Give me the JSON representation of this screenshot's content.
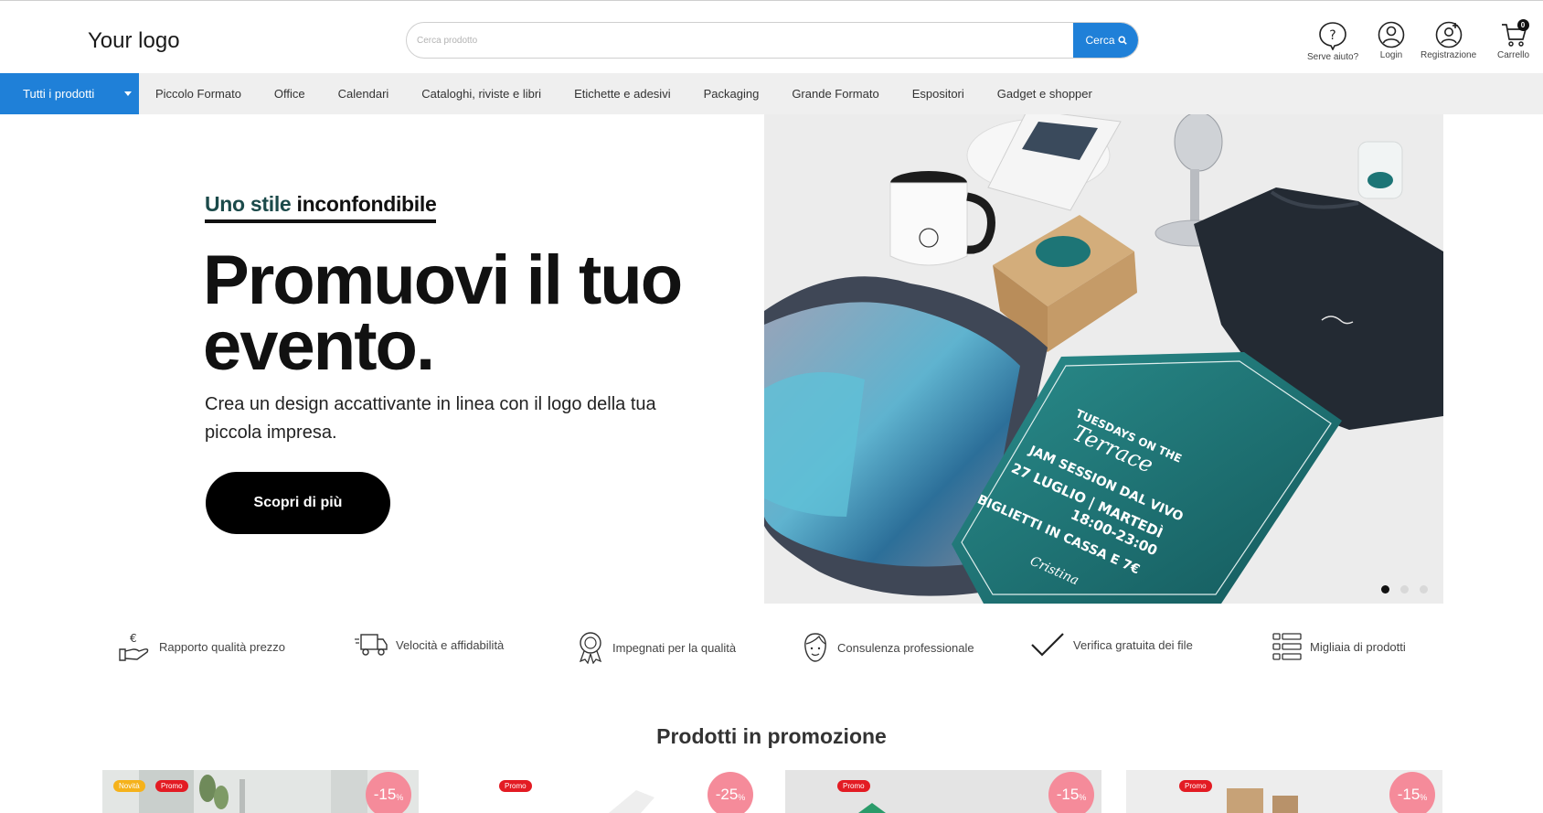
{
  "header": {
    "logo": "Your logo",
    "search_placeholder": "Cerca prodotto",
    "search_button": "Cerca",
    "icons": [
      {
        "name": "help-icon",
        "label": "Serve aiuto?"
      },
      {
        "name": "login-icon",
        "label": "Login"
      },
      {
        "name": "register-icon",
        "label": "Registrazione"
      },
      {
        "name": "cart-icon",
        "label": "Carrello"
      }
    ],
    "cart_count": "0"
  },
  "nav": {
    "all_products": "Tutti i prodotti",
    "items": [
      "Piccolo Formato",
      "Office",
      "Calendari",
      "Cataloghi, riviste e libri",
      "Etichette e adesivi",
      "Packaging",
      "Grande Formato",
      "Espositori",
      "Gadget e shopper"
    ]
  },
  "hero": {
    "kicker_part1": "Uno stile",
    "kicker_part2": "inconfondibile",
    "headline": "Promuovi il tuo evento.",
    "subtext": "Crea un design accattivante in linea con il logo della tua piccola impresa.",
    "cta": "Scopri di più",
    "poster": {
      "line1": "TUESDAYS ON THE",
      "line2": "Terrace",
      "line3": "JAM SESSION DAL VIVO",
      "line4": "27 LUGLIO | MARTEDÌ",
      "line5": "18:00-23:00",
      "line6": "BIGLIETTI IN CASSA E 7€",
      "brand": "Cristina"
    },
    "slides": 3,
    "active_slide": 1
  },
  "features": [
    {
      "icon": "euro-hand-icon",
      "label": "Rapporto qualità prezzo"
    },
    {
      "icon": "delivery-truck-icon",
      "label": "Velocità e affidabilità"
    },
    {
      "icon": "award-ribbon-icon",
      "label": "Impegnati per la qualità"
    },
    {
      "icon": "consultant-face-icon",
      "label": "Consulenza professionale"
    },
    {
      "icon": "checkmark-icon",
      "label": "Verifica gratuita dei file"
    },
    {
      "icon": "list-icon",
      "label": "Migliaia di prodotti"
    }
  ],
  "promo": {
    "title": "Prodotti in promozione",
    "cards": [
      {
        "badges": [
          "Novità",
          "Promo"
        ],
        "discount": "-15",
        "unit": "%"
      },
      {
        "badges": [
          "Promo"
        ],
        "discount": "-25",
        "unit": "%"
      },
      {
        "badges": [
          "Promo"
        ],
        "discount": "-15",
        "unit": "%"
      },
      {
        "badges": [
          "Promo"
        ],
        "discount": "-15",
        "unit": "%"
      }
    ]
  },
  "colors": {
    "accent": "#1f80d8",
    "nav_bg": "#efefef",
    "poster_teal": "#1d7576",
    "promo_badge": "#e31b23",
    "novita_badge": "#f5b21b",
    "discount_bg": "#f58b9a"
  }
}
